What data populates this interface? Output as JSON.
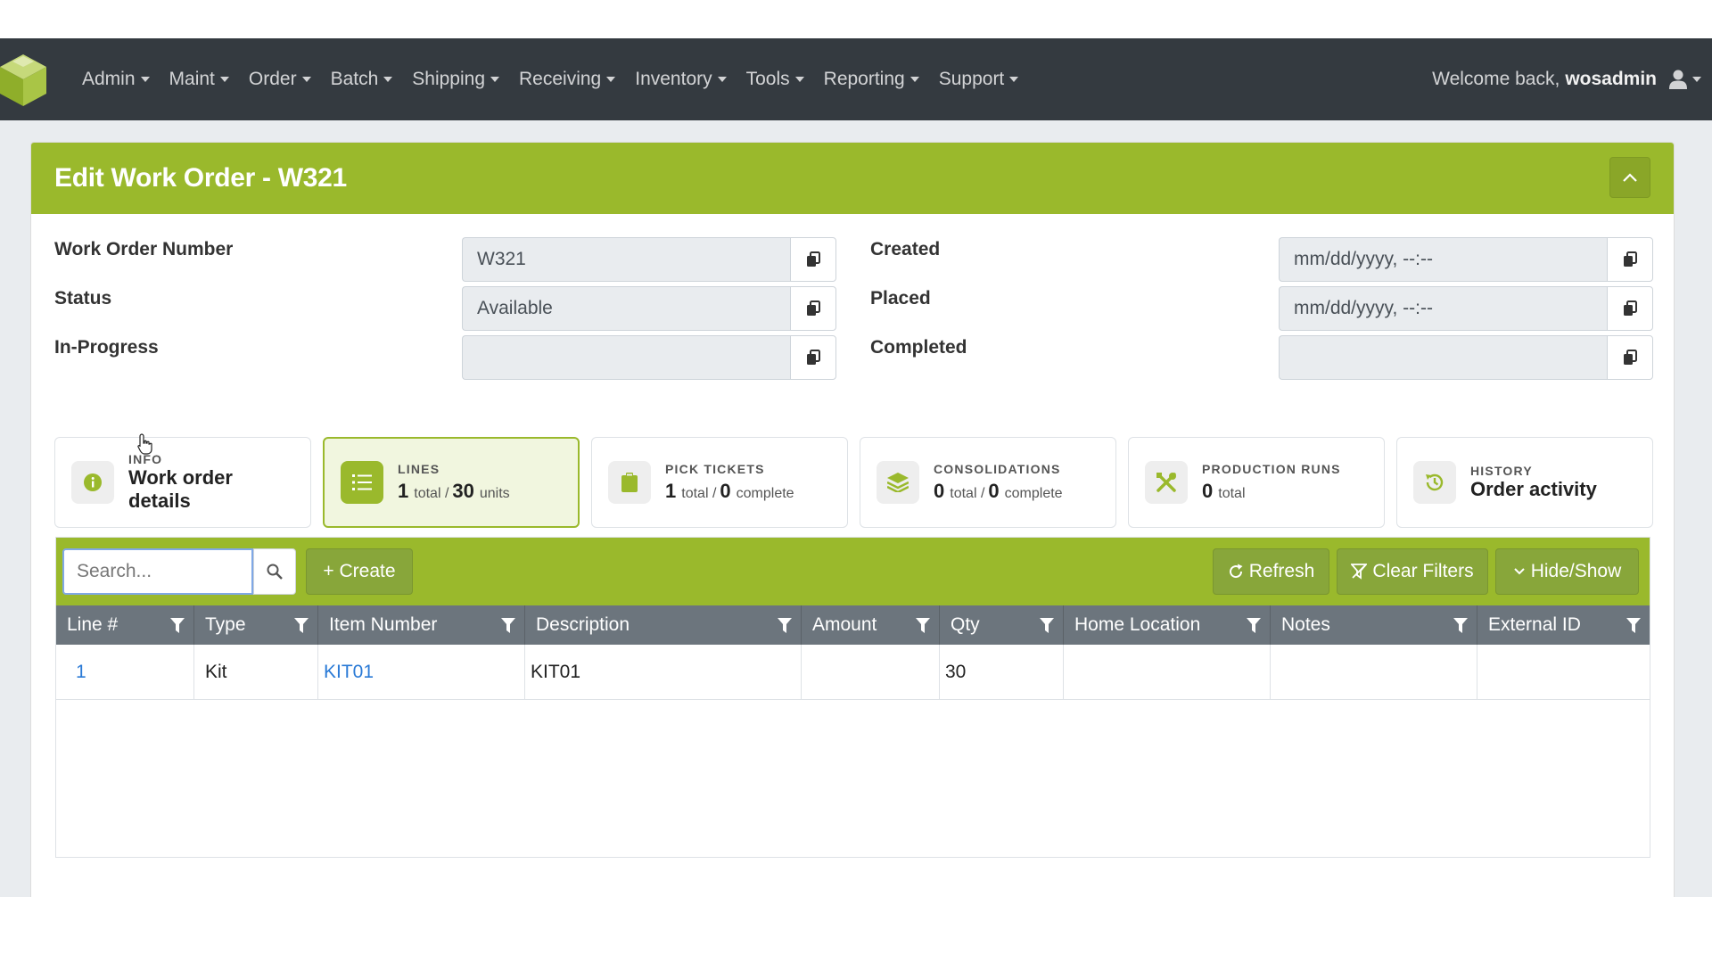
{
  "navbar": {
    "menu": [
      {
        "label": "Admin"
      },
      {
        "label": "Maint"
      },
      {
        "label": "Order"
      },
      {
        "label": "Batch"
      },
      {
        "label": "Shipping"
      },
      {
        "label": "Receiving"
      },
      {
        "label": "Inventory"
      },
      {
        "label": "Tools"
      },
      {
        "label": "Reporting"
      },
      {
        "label": "Support"
      }
    ],
    "welcome_text": "Welcome back,",
    "username": "wosadmin",
    "icons": {
      "brand": "cube-logo-icon",
      "user": "user-icon"
    }
  },
  "page": {
    "title": "Edit Work Order - W321"
  },
  "form": {
    "left": [
      {
        "label": "Work Order Number",
        "value": "W321"
      },
      {
        "label": "Status",
        "value": "Available"
      },
      {
        "label": "In-Progress",
        "value": ""
      }
    ],
    "right": [
      {
        "label": "Created",
        "value": "mm/dd/yyyy, --:--"
      },
      {
        "label": "Placed",
        "value": "mm/dd/yyyy, --:--"
      },
      {
        "label": "Completed",
        "value": ""
      }
    ]
  },
  "tabs": {
    "info": {
      "label": "INFO",
      "title": "Work order details"
    },
    "lines": {
      "label": "LINES",
      "total": "1",
      "total_word": "total /",
      "units": "30",
      "units_word": "units"
    },
    "pick_tickets": {
      "label": "PICK TICKETS",
      "total": "1",
      "total_word": "total /",
      "complete": "0",
      "complete_word": "complete"
    },
    "consolidations": {
      "label": "CONSOLIDATIONS",
      "total": "0",
      "total_word": "total /",
      "complete": "0",
      "complete_word": "complete"
    },
    "production_runs": {
      "label": "PRODUCTION RUNS",
      "total": "0",
      "total_word": "total"
    },
    "history": {
      "label": "HISTORY",
      "title": "Order activity"
    }
  },
  "toolbar": {
    "search_placeholder": "Search...",
    "create_label": "+ Create",
    "refresh_label": "Refresh",
    "clear_filters_label": "Clear Filters",
    "hide_show_label": "Hide/Show"
  },
  "table": {
    "columns": [
      "Line #",
      "Type",
      "Item Number",
      "Description",
      "Amount",
      "Qty",
      "Home Location",
      "Notes",
      "External ID"
    ],
    "rows": [
      {
        "line": "1",
        "type": "Kit",
        "item_number": "KIT01",
        "description": "KIT01",
        "amount": "",
        "qty": "30",
        "home_location": "",
        "notes": "",
        "external_id": ""
      }
    ]
  },
  "colors": {
    "accent": "#9ab92c",
    "navbar": "#343a40",
    "link": "#2a7ad6",
    "table_header": "#6c757d"
  }
}
